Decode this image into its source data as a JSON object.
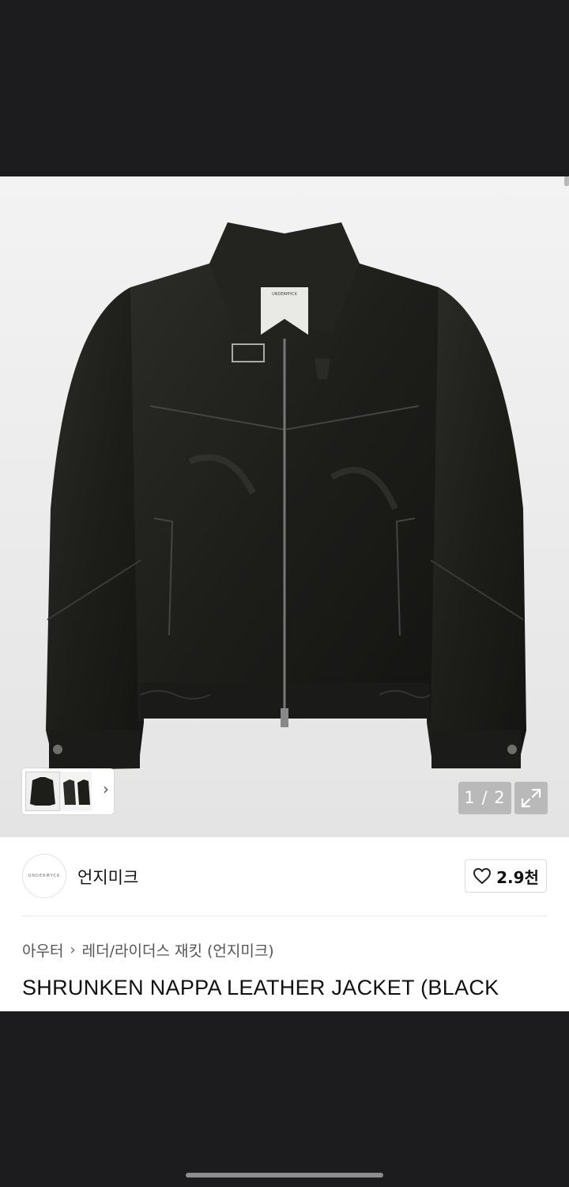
{
  "gallery": {
    "page_indicator": "1 / 2",
    "thumbnails": [
      "jacket-front",
      "jacket-side-back"
    ],
    "jacket_label_text": "UNDERMYCK"
  },
  "brand": {
    "name": "언지미크",
    "logo_text": "UNDERMYCK",
    "likes": "2.9천"
  },
  "breadcrumb": {
    "category": "아우터",
    "subcategory": "레더/라이더스 재킷 (언지미크)"
  },
  "product": {
    "title": "SHRUNKEN NAPPA LEATHER JACKET (BLACK"
  },
  "icons": {
    "heart": "heart-icon",
    "expand": "expand-icon",
    "chevron": "chevron-right-icon"
  }
}
